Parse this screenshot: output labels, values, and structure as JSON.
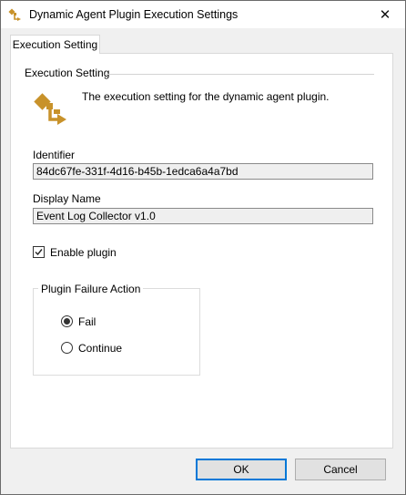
{
  "window": {
    "title": "Dynamic Agent Plugin Execution Settings",
    "app_icon": "plugin-flow-icon",
    "close_glyph": "✕"
  },
  "tabs": [
    {
      "label": "Execution Setting",
      "selected": true
    }
  ],
  "section": {
    "header": "Execution Setting",
    "icon": "plugin-flow-icon",
    "description": "The execution setting for the dynamic agent plugin."
  },
  "identifier": {
    "label": "Identifier",
    "value": "84dc67fe-331f-4d16-b45b-1edca6a4a7bd"
  },
  "display_name": {
    "label": "Display Name",
    "value": "Event Log Collector v1.0"
  },
  "enable_plugin": {
    "label": "Enable plugin",
    "checked": true
  },
  "failure_action": {
    "legend": "Plugin Failure Action",
    "options": [
      {
        "label": "Fail",
        "selected": true
      },
      {
        "label": "Continue",
        "selected": false
      }
    ]
  },
  "buttons": {
    "ok": "OK",
    "cancel": "Cancel"
  },
  "colors": {
    "icon_accent": "#c8922a",
    "focus_border": "#0078d7"
  }
}
